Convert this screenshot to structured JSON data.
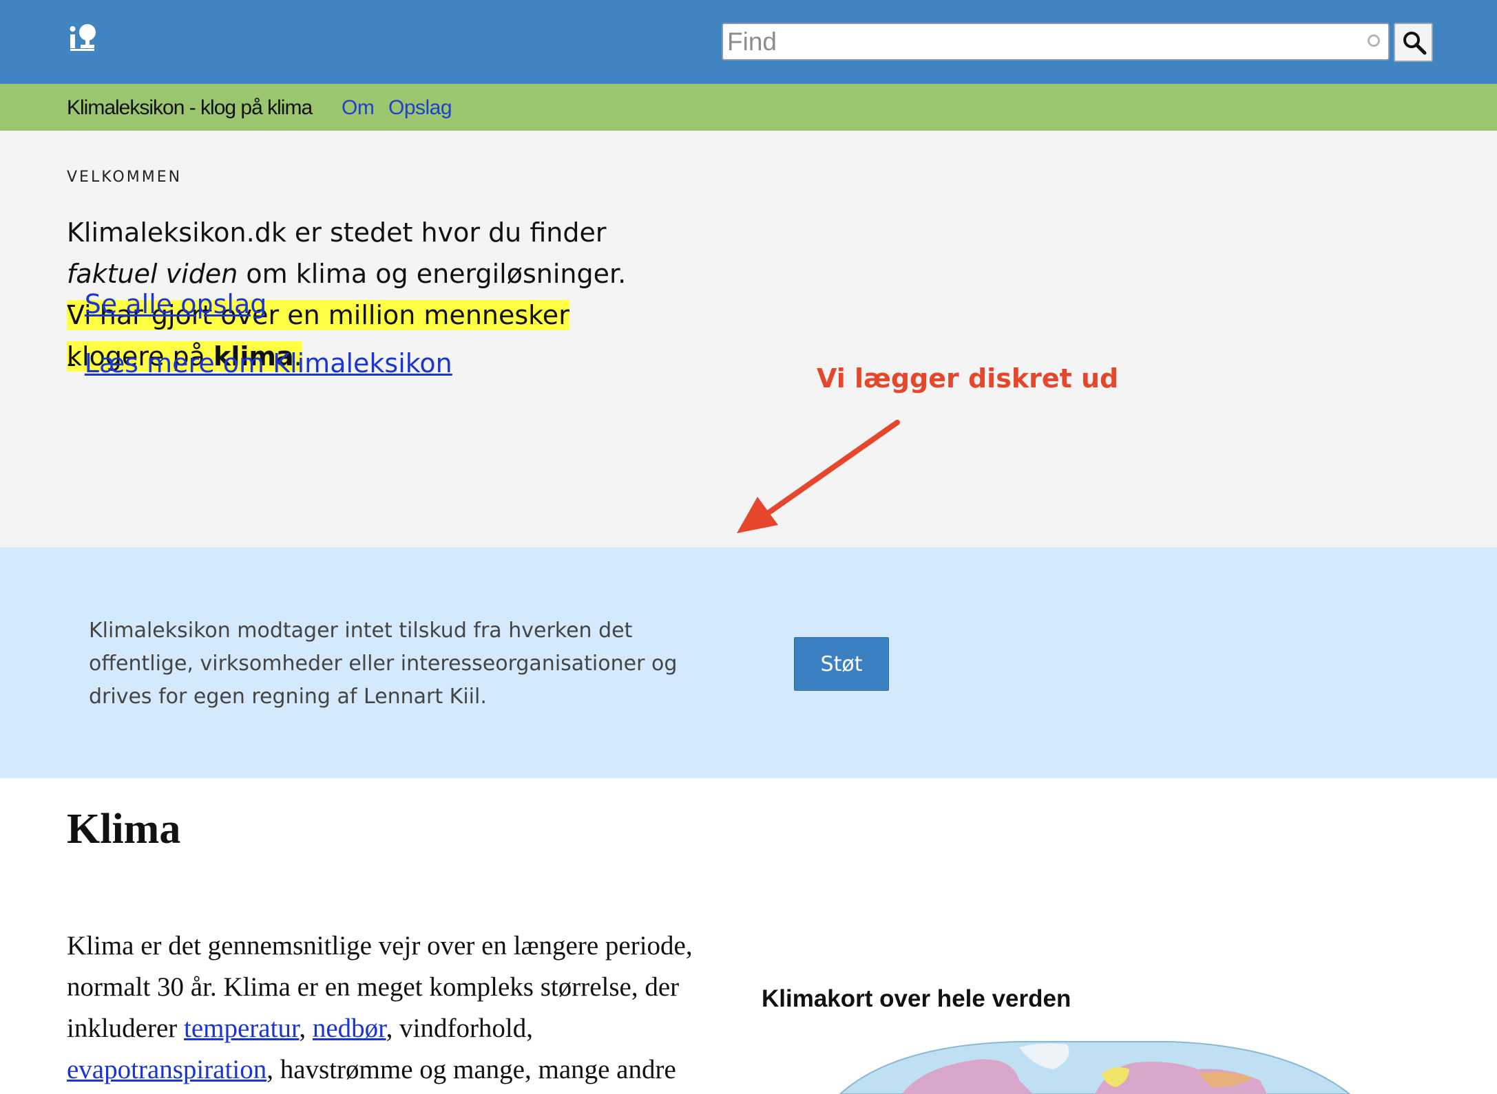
{
  "header": {
    "logo_icon": "klimaleksikon-logo-icon",
    "search": {
      "value": "",
      "placeholder": "Find"
    },
    "search_icon": "magnifier-icon"
  },
  "nav": {
    "site_title": "Klimaleksikon - klog på klima",
    "links": [
      "Om",
      "Opslag"
    ]
  },
  "welcome": {
    "eyebrow": "VELKOMMEN",
    "line1": "Klimaleksikon.dk er stedet hvor du finder",
    "line2_em": "faktuel viden",
    "line2_rest": " om klima og energiløsninger.",
    "hl_line1": "Vi har gjort over en million mennesker",
    "hl_line2_pre": "klogere på ",
    "hl_line2_bold": "klima",
    "hl_line2_post": ".",
    "links": [
      {
        "prefix": "- ",
        "label": "Se alle opslag"
      },
      {
        "prefix": "- ",
        "label": "Læs mere om Klimaleksikon"
      }
    ],
    "highlight_color": "#ffff44"
  },
  "annotation": {
    "text": "Vi lægger diskret ud",
    "color": "#e5462c"
  },
  "support": {
    "text": "Klimaleksikon modtager intet tilskud fra hverken det offentlige, virksomheder eller interesseorganisationer og drives for egen regning af Lennart Kiil.",
    "button_label": "Støt"
  },
  "article": {
    "title": "Klima",
    "body": {
      "t1": "Klima er det gennemsnitlige vejr over en længere periode, normalt 30 år. Klima er en meget kompleks størrelse, der inkluderer ",
      "link1": "temperatur",
      "t2": ", ",
      "link2": "nedbør",
      "t3": ", vindforhold, ",
      "link3": "evapotranspiration",
      "t4": ", havstrømme og mange, mange andre"
    },
    "map_heading": "Klimakort over hele verden"
  },
  "colors": {
    "topbar": "#4085c2",
    "subnav": "#9bc56e",
    "welcome_bg": "#f4f4f4",
    "support_bg": "#d4e9fb",
    "link": "#1a35d4"
  }
}
